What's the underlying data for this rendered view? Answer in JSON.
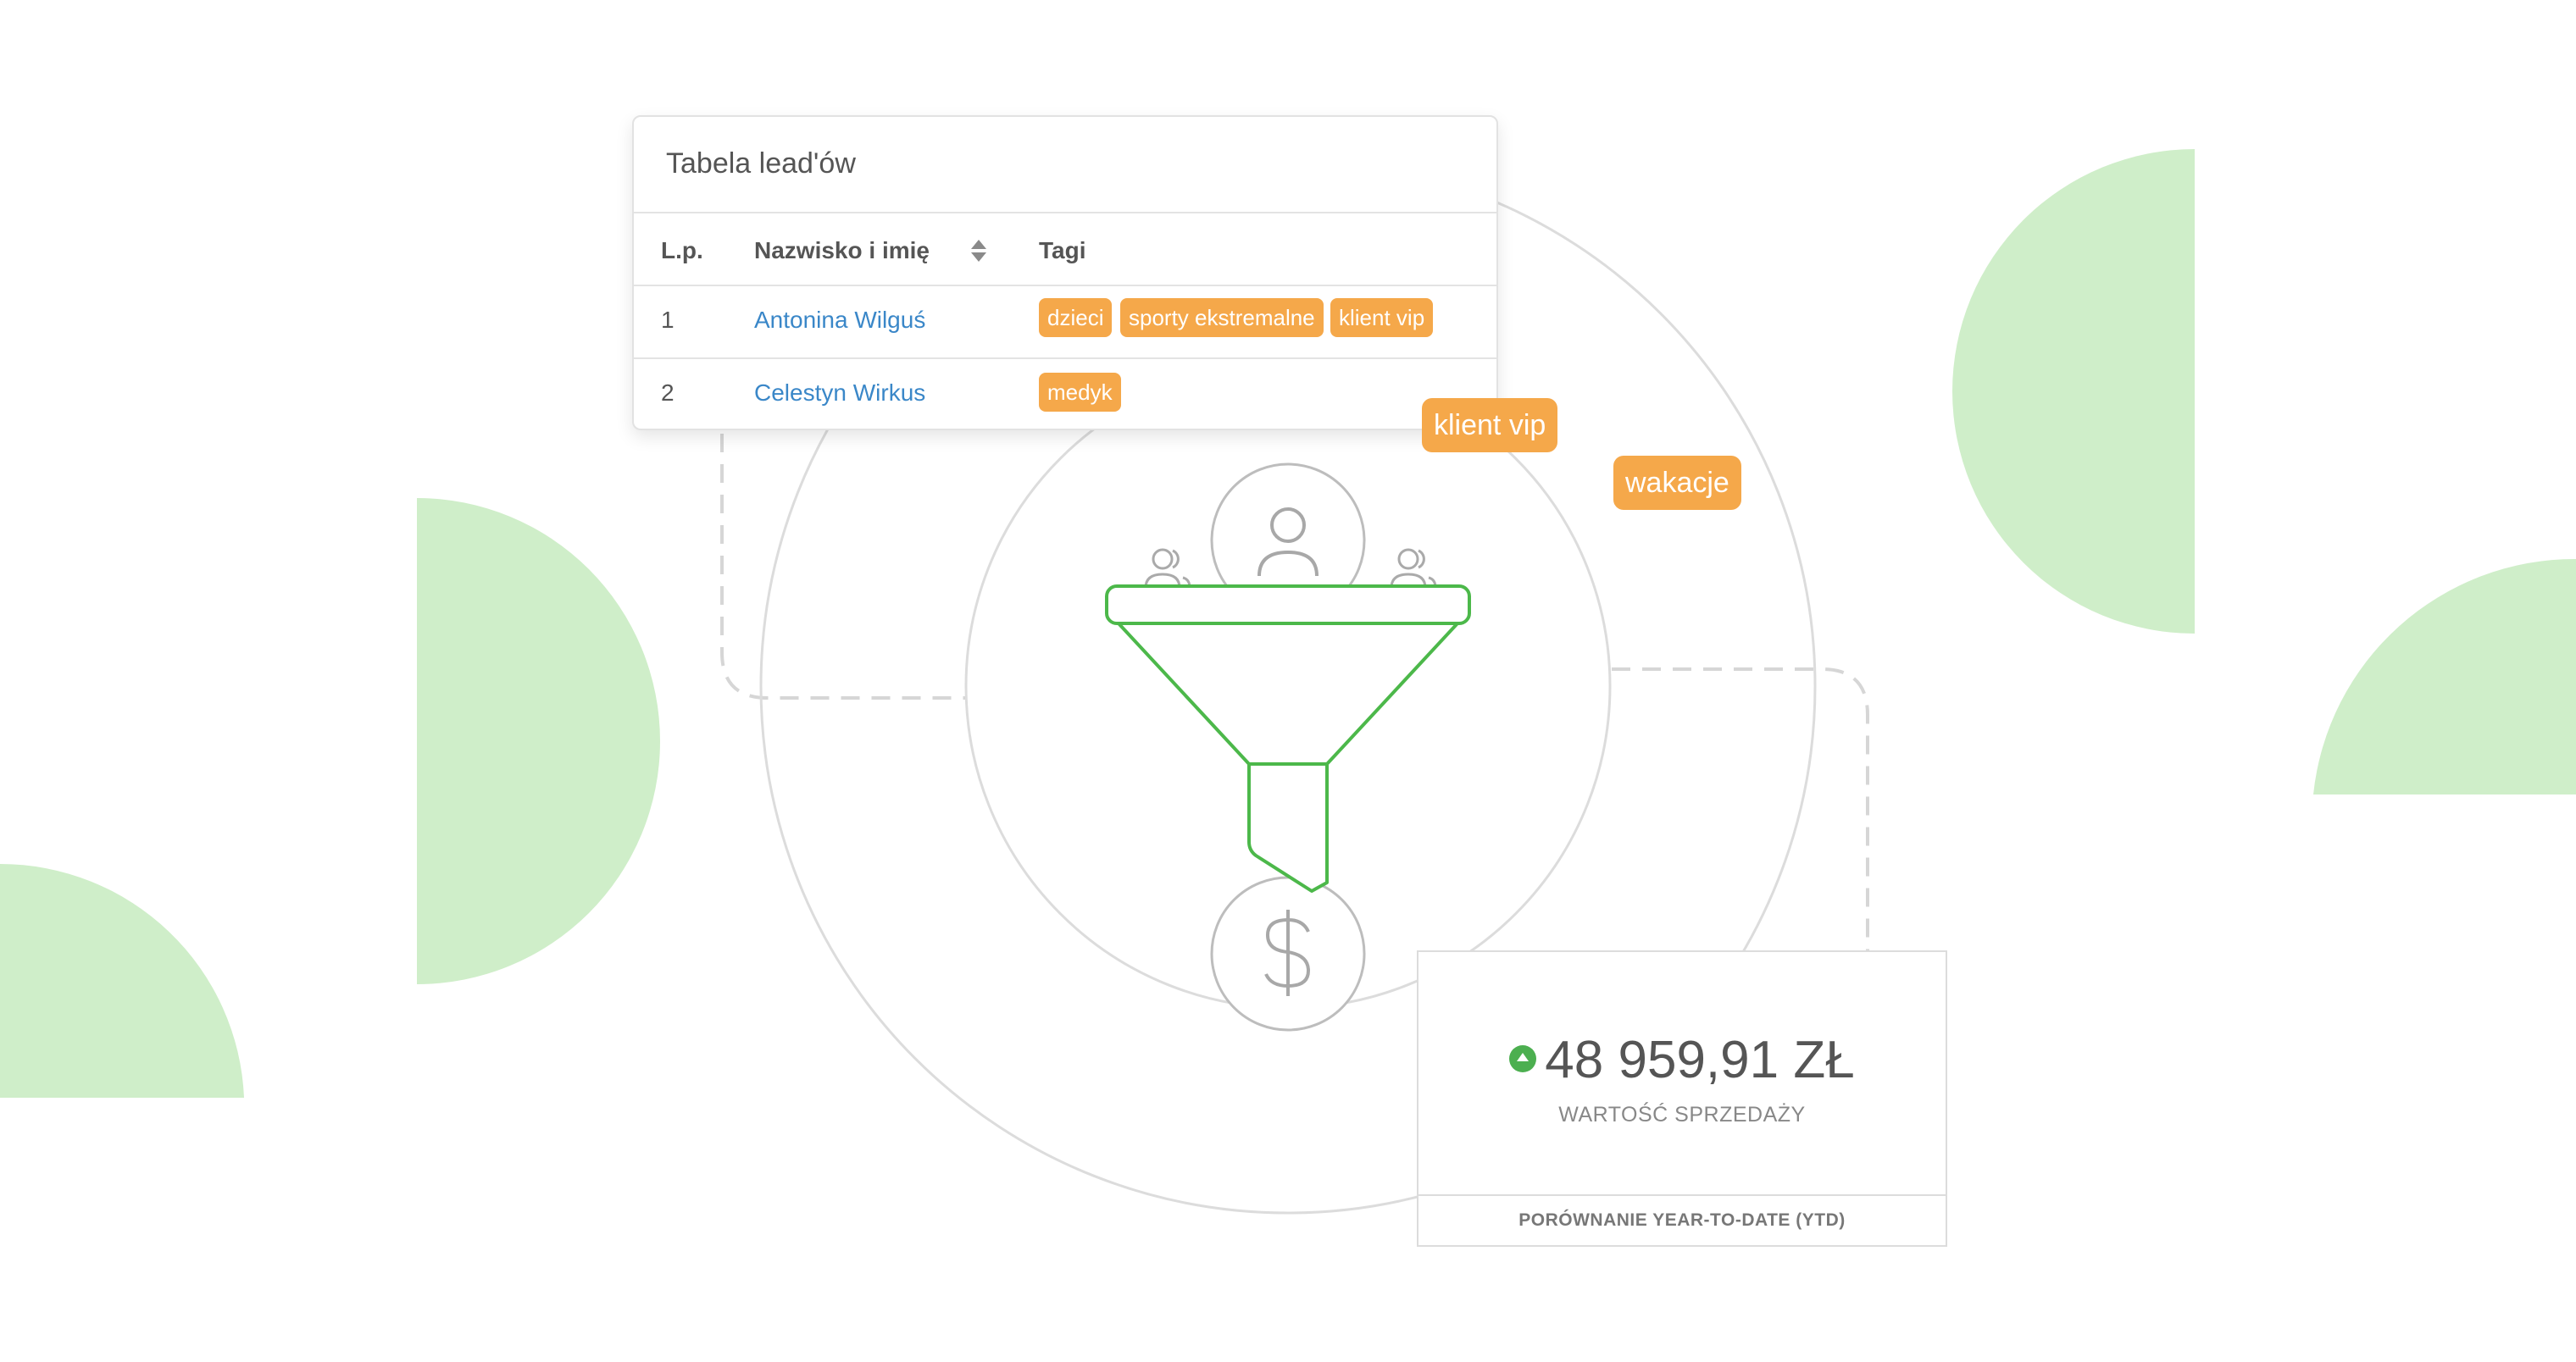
{
  "colors": {
    "accent_green": "#4caf50",
    "shape_green": "#cfeec9",
    "tag_orange": "#f5a84a",
    "link_blue": "#3a87c8"
  },
  "leads_table": {
    "title": "Tabela lead'ów",
    "columns": {
      "index": "L.p.",
      "name": "Nazwisko i imię",
      "tags": "Tagi"
    },
    "rows": [
      {
        "index": "1",
        "name": "Antonina Wilguś",
        "tags": [
          "dzieci",
          "sporty ekstremalne",
          "klient vip"
        ]
      },
      {
        "index": "2",
        "name": "Celestyn Wirkus",
        "tags": [
          "medyk"
        ]
      }
    ]
  },
  "floating_tags": [
    "klient vip",
    "wakacje"
  ],
  "icons": [
    "person-icon",
    "group-icon",
    "funnel-icon",
    "dollar-icon",
    "sort-icon",
    "arrow-up-icon"
  ],
  "sales": {
    "value": "48 959,91 ZŁ",
    "label": "WARTOŚĆ SPRZEDAŻY",
    "footer": "PORÓWNANIE YEAR-TO-DATE (YTD)"
  }
}
